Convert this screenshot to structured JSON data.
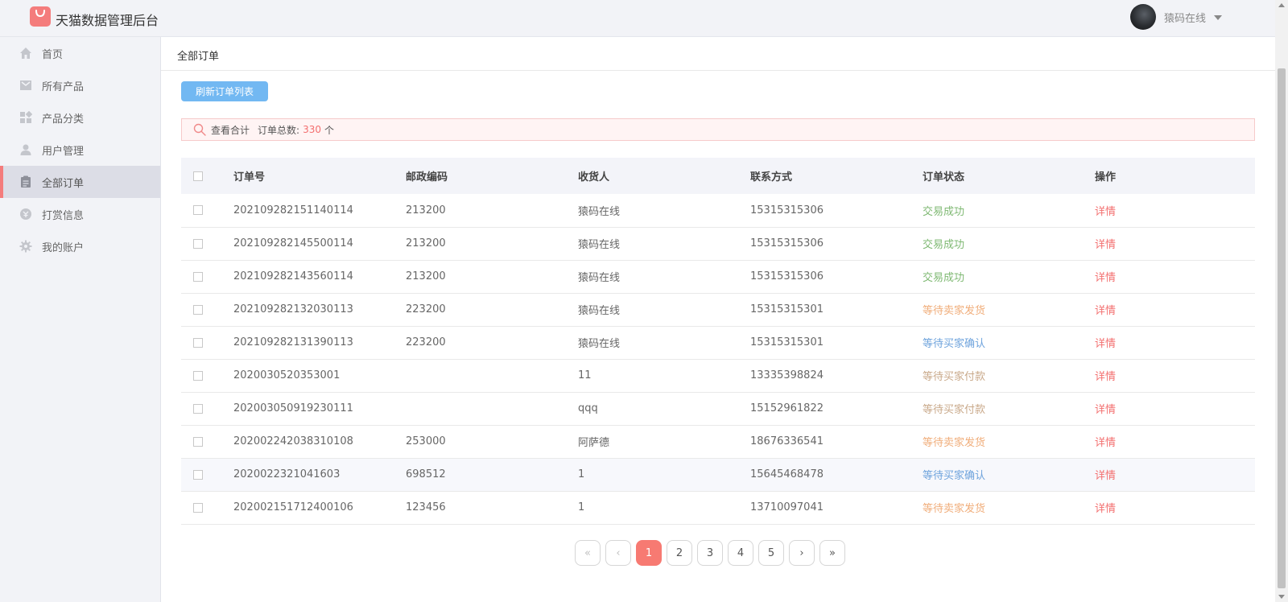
{
  "header": {
    "app_title": "天猫数据管理后台",
    "user_name": "猿码在线"
  },
  "sidebar": {
    "items": [
      {
        "label": "首页",
        "icon": "home-icon"
      },
      {
        "label": "所有产品",
        "icon": "product-icon"
      },
      {
        "label": "产品分类",
        "icon": "category-icon"
      },
      {
        "label": "用户管理",
        "icon": "user-icon"
      },
      {
        "label": "全部订单",
        "icon": "order-icon",
        "active": true
      },
      {
        "label": "打赏信息",
        "icon": "reward-icon"
      },
      {
        "label": "我的账户",
        "icon": "gear-icon"
      }
    ]
  },
  "main": {
    "breadcrumb": "全部订单",
    "refresh_label": "刷新订单列表",
    "summary": {
      "label": "查看合计",
      "total_label": "订单总数:",
      "count": "330",
      "unit": "个"
    },
    "table": {
      "headers": [
        "订单号",
        "邮政编码",
        "收货人",
        "联系方式",
        "订单状态",
        "操作"
      ],
      "rows": [
        {
          "order_no": "202109282151140114",
          "zip": "213200",
          "receiver": "猿码在线",
          "phone": "15315315306",
          "status": "交易成功",
          "status_type": "success",
          "action": "详情"
        },
        {
          "order_no": "202109282145500114",
          "zip": "213200",
          "receiver": "猿码在线",
          "phone": "15315315306",
          "status": "交易成功",
          "status_type": "success",
          "action": "详情"
        },
        {
          "order_no": "202109282143560114",
          "zip": "213200",
          "receiver": "猿码在线",
          "phone": "15315315306",
          "status": "交易成功",
          "status_type": "success",
          "action": "详情"
        },
        {
          "order_no": "202109282132030113",
          "zip": "223200",
          "receiver": "猿码在线",
          "phone": "15315315301",
          "status": "等待卖家发货",
          "status_type": "seller",
          "action": "详情"
        },
        {
          "order_no": "202109282131390113",
          "zip": "223200",
          "receiver": "猿码在线",
          "phone": "15315315301",
          "status": "等待买家确认",
          "status_type": "confirm",
          "action": "详情"
        },
        {
          "order_no": "2020030520353001",
          "zip": "",
          "receiver": "11",
          "phone": "13335398824",
          "status": "等待买家付款",
          "status_type": "pay",
          "action": "详情"
        },
        {
          "order_no": "202003050919230111",
          "zip": "",
          "receiver": "qqq",
          "phone": "15152961822",
          "status": "等待买家付款",
          "status_type": "pay",
          "action": "详情"
        },
        {
          "order_no": "202002242038310108",
          "zip": "253000",
          "receiver": "阿萨德",
          "phone": "18676336541",
          "status": "等待卖家发货",
          "status_type": "seller",
          "action": "详情"
        },
        {
          "order_no": "2020022321041603",
          "zip": "698512",
          "receiver": "1",
          "phone": "15645468478",
          "status": "等待买家确认",
          "status_type": "confirm",
          "action": "详情",
          "highlighted": true
        },
        {
          "order_no": "202002151712400106",
          "zip": "123456",
          "receiver": "1",
          "phone": "13710097041",
          "status": "等待卖家发货",
          "status_type": "seller",
          "action": "详情"
        }
      ]
    },
    "pagination": {
      "first": "«",
      "prev": "‹",
      "pages": [
        "1",
        "2",
        "3",
        "4",
        "5"
      ],
      "current": "1",
      "next": "›",
      "last": "»"
    }
  },
  "colors": {
    "accent": "#f77a72",
    "refresh_button": "#72b8f2",
    "status_success": "#7fb973",
    "status_seller": "#f0ad7a",
    "status_confirm": "#6ea3dc",
    "status_pay": "#c9a98a"
  }
}
